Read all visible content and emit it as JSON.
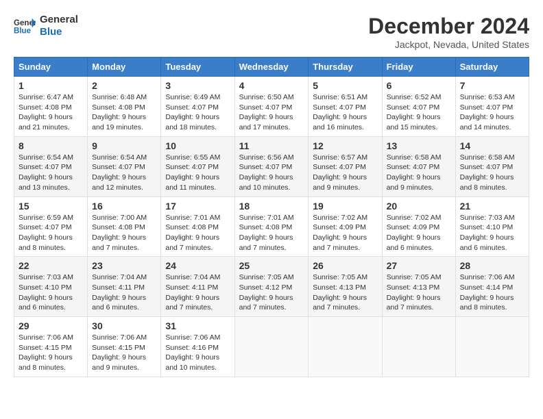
{
  "logo": {
    "line1": "General",
    "line2": "Blue"
  },
  "title": "December 2024",
  "subtitle": "Jackpot, Nevada, United States",
  "days_of_week": [
    "Sunday",
    "Monday",
    "Tuesday",
    "Wednesday",
    "Thursday",
    "Friday",
    "Saturday"
  ],
  "weeks": [
    [
      {
        "day": "1",
        "sunrise": "6:47 AM",
        "sunset": "4:08 PM",
        "daylight": "9 hours and 21 minutes."
      },
      {
        "day": "2",
        "sunrise": "6:48 AM",
        "sunset": "4:08 PM",
        "daylight": "9 hours and 19 minutes."
      },
      {
        "day": "3",
        "sunrise": "6:49 AM",
        "sunset": "4:07 PM",
        "daylight": "9 hours and 18 minutes."
      },
      {
        "day": "4",
        "sunrise": "6:50 AM",
        "sunset": "4:07 PM",
        "daylight": "9 hours and 17 minutes."
      },
      {
        "day": "5",
        "sunrise": "6:51 AM",
        "sunset": "4:07 PM",
        "daylight": "9 hours and 16 minutes."
      },
      {
        "day": "6",
        "sunrise": "6:52 AM",
        "sunset": "4:07 PM",
        "daylight": "9 hours and 15 minutes."
      },
      {
        "day": "7",
        "sunrise": "6:53 AM",
        "sunset": "4:07 PM",
        "daylight": "9 hours and 14 minutes."
      }
    ],
    [
      {
        "day": "8",
        "sunrise": "6:54 AM",
        "sunset": "4:07 PM",
        "daylight": "9 hours and 13 minutes."
      },
      {
        "day": "9",
        "sunrise": "6:54 AM",
        "sunset": "4:07 PM",
        "daylight": "9 hours and 12 minutes."
      },
      {
        "day": "10",
        "sunrise": "6:55 AM",
        "sunset": "4:07 PM",
        "daylight": "9 hours and 11 minutes."
      },
      {
        "day": "11",
        "sunrise": "6:56 AM",
        "sunset": "4:07 PM",
        "daylight": "9 hours and 10 minutes."
      },
      {
        "day": "12",
        "sunrise": "6:57 AM",
        "sunset": "4:07 PM",
        "daylight": "9 hours and 9 minutes."
      },
      {
        "day": "13",
        "sunrise": "6:58 AM",
        "sunset": "4:07 PM",
        "daylight": "9 hours and 9 minutes."
      },
      {
        "day": "14",
        "sunrise": "6:58 AM",
        "sunset": "4:07 PM",
        "daylight": "9 hours and 8 minutes."
      }
    ],
    [
      {
        "day": "15",
        "sunrise": "6:59 AM",
        "sunset": "4:07 PM",
        "daylight": "9 hours and 8 minutes."
      },
      {
        "day": "16",
        "sunrise": "7:00 AM",
        "sunset": "4:08 PM",
        "daylight": "9 hours and 7 minutes."
      },
      {
        "day": "17",
        "sunrise": "7:01 AM",
        "sunset": "4:08 PM",
        "daylight": "9 hours and 7 minutes."
      },
      {
        "day": "18",
        "sunrise": "7:01 AM",
        "sunset": "4:08 PM",
        "daylight": "9 hours and 7 minutes."
      },
      {
        "day": "19",
        "sunrise": "7:02 AM",
        "sunset": "4:09 PM",
        "daylight": "9 hours and 7 minutes."
      },
      {
        "day": "20",
        "sunrise": "7:02 AM",
        "sunset": "4:09 PM",
        "daylight": "9 hours and 6 minutes."
      },
      {
        "day": "21",
        "sunrise": "7:03 AM",
        "sunset": "4:10 PM",
        "daylight": "9 hours and 6 minutes."
      }
    ],
    [
      {
        "day": "22",
        "sunrise": "7:03 AM",
        "sunset": "4:10 PM",
        "daylight": "9 hours and 6 minutes."
      },
      {
        "day": "23",
        "sunrise": "7:04 AM",
        "sunset": "4:11 PM",
        "daylight": "9 hours and 6 minutes."
      },
      {
        "day": "24",
        "sunrise": "7:04 AM",
        "sunset": "4:11 PM",
        "daylight": "9 hours and 7 minutes."
      },
      {
        "day": "25",
        "sunrise": "7:05 AM",
        "sunset": "4:12 PM",
        "daylight": "9 hours and 7 minutes."
      },
      {
        "day": "26",
        "sunrise": "7:05 AM",
        "sunset": "4:13 PM",
        "daylight": "9 hours and 7 minutes."
      },
      {
        "day": "27",
        "sunrise": "7:05 AM",
        "sunset": "4:13 PM",
        "daylight": "9 hours and 7 minutes."
      },
      {
        "day": "28",
        "sunrise": "7:06 AM",
        "sunset": "4:14 PM",
        "daylight": "9 hours and 8 minutes."
      }
    ],
    [
      {
        "day": "29",
        "sunrise": "7:06 AM",
        "sunset": "4:15 PM",
        "daylight": "9 hours and 8 minutes."
      },
      {
        "day": "30",
        "sunrise": "7:06 AM",
        "sunset": "4:15 PM",
        "daylight": "9 hours and 9 minutes."
      },
      {
        "day": "31",
        "sunrise": "7:06 AM",
        "sunset": "4:16 PM",
        "daylight": "9 hours and 10 minutes."
      },
      null,
      null,
      null,
      null
    ]
  ],
  "colors": {
    "header_bg": "#3a7dc9",
    "logo_blue": "#1a6eb5"
  }
}
